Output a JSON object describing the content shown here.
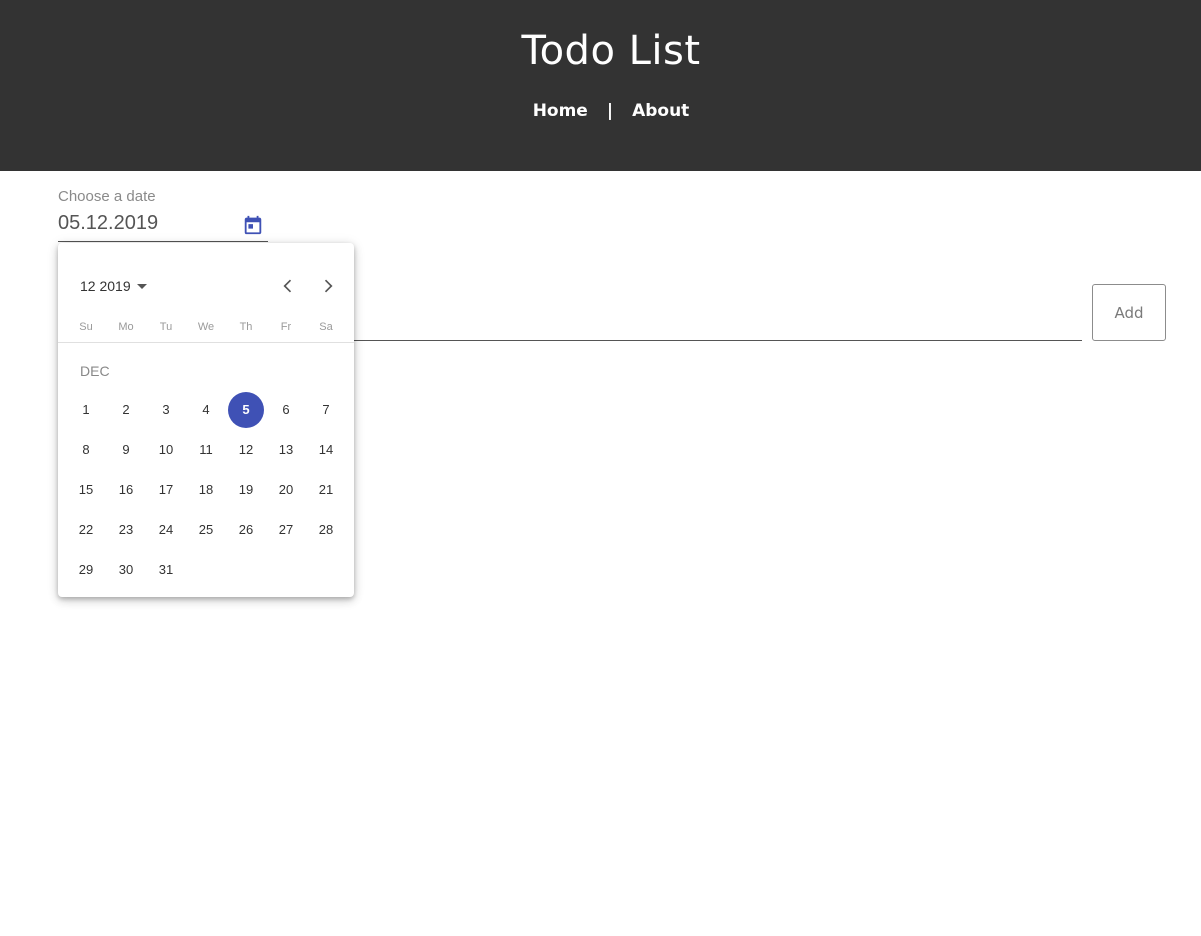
{
  "header": {
    "title": "Todo List",
    "nav": {
      "home": "Home",
      "separator": "|",
      "about": "About"
    },
    "background_color": "#333333"
  },
  "date_field": {
    "label": "Choose a date",
    "value": "05.12.2019",
    "toggle_icon": "calendar-icon"
  },
  "todo": {
    "add_label": "Add"
  },
  "datepicker": {
    "period_label": "12 2019",
    "prev_icon": "chevron-left-icon",
    "next_icon": "chevron-right-icon",
    "weekdays": [
      "Su",
      "Mo",
      "Tu",
      "We",
      "Th",
      "Fr",
      "Sa"
    ],
    "month_label": "DEC",
    "first_weekday_index": 0,
    "days": [
      "1",
      "2",
      "3",
      "4",
      "5",
      "6",
      "7",
      "8",
      "9",
      "10",
      "11",
      "12",
      "13",
      "14",
      "15",
      "16",
      "17",
      "18",
      "19",
      "20",
      "21",
      "22",
      "23",
      "24",
      "25",
      "26",
      "27",
      "28",
      "29",
      "30",
      "31"
    ],
    "selected_day": "5",
    "accent_color": "#3f51b5"
  }
}
